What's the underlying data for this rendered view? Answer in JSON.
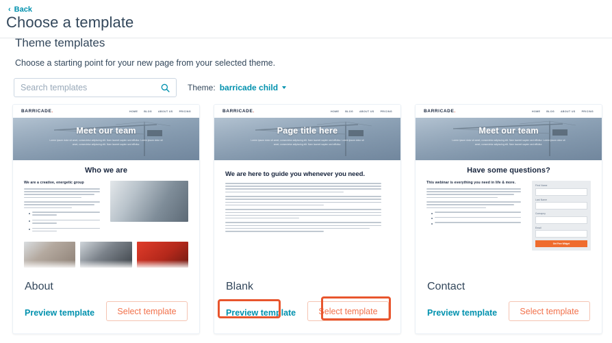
{
  "header": {
    "back_label": "Back",
    "back_icon": "chevron-left-icon",
    "title": "Choose a template"
  },
  "section": {
    "title": "Theme templates",
    "subtitle": "Choose a starting point for your new page from your selected theme."
  },
  "search": {
    "placeholder": "Search templates",
    "value": "",
    "icon": "search-icon"
  },
  "theme_filter": {
    "label": "Theme:",
    "value": "barricade child",
    "caret_icon": "chevron-down-icon"
  },
  "colors": {
    "link_teal": "#0091ae",
    "heading_navy": "#33475b",
    "button_coral": "#f2714b",
    "button_border": "#f5c3b1",
    "annotation_orange": "#e8552d",
    "mini_navy": "#17243c",
    "mini_orange": "#ef6c2e",
    "logo_dot_red": "#d5402b"
  },
  "mini_site": {
    "logo": "BARRICADE",
    "logo_dot": ".",
    "nav": [
      "HOME",
      "BLOG",
      "ABOUT US",
      "PRICING"
    ],
    "hero_paragraph": "Lorem ipsum dolor sit amet, consectetur adipiscing elit. Nam laoreet sapien sed efficitur. Lorem ipsum dolor sit amet, consectetur adipiscing elit. Nam laoreet sapien sed efficitur."
  },
  "cards": [
    {
      "name": "About",
      "preview_label": "Preview template",
      "select_label": "Select template",
      "hero_title": "Meet our team",
      "body_heading": "Who we are",
      "sub_heading": "We are a creative, energetic group",
      "highlighted_preview": false,
      "highlighted_select": false
    },
    {
      "name": "Blank",
      "preview_label": "Preview template",
      "select_label": "Select template",
      "hero_title": "Page title here",
      "body_heading": "We are here to guide you whenever you need.",
      "sub_heading": "",
      "highlighted_preview": true,
      "highlighted_select": true
    },
    {
      "name": "Contact",
      "preview_label": "Preview template",
      "select_label": "Select template",
      "hero_title": "Meet our team",
      "body_heading": "Have some questions?",
      "sub_heading": "This webinar is everything you need in life & more.",
      "form_fields": [
        "First Name",
        "Last Name",
        "Comapny",
        "Email"
      ],
      "form_button": "Get Free Widget",
      "highlighted_preview": false,
      "highlighted_select": false
    }
  ]
}
